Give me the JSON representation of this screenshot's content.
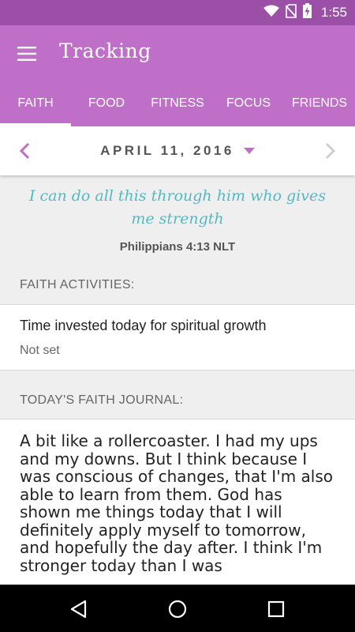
{
  "status_bar": {
    "time": "1:55",
    "icons": [
      "wifi-icon",
      "no-sim-icon",
      "battery-charging-icon"
    ]
  },
  "app_bar": {
    "title": "Tracking",
    "menu_icon": "hamburger-menu-icon"
  },
  "tabs": [
    {
      "label": "FAITH",
      "active": true
    },
    {
      "label": "FOOD",
      "active": false
    },
    {
      "label": "FITNESS",
      "active": false
    },
    {
      "label": "FOCUS",
      "active": false
    },
    {
      "label": "FRIENDS",
      "active": false
    }
  ],
  "date_nav": {
    "date": "APRIL 11, 2016",
    "prev_icon": "chevron-left-icon",
    "next_icon": "chevron-right-icon",
    "dropdown_icon": "caret-down-icon"
  },
  "verse": {
    "text": "I can do all this through him who gives me strength",
    "reference": "Philippians 4:13 NLT"
  },
  "faith_activities": {
    "header": "FAITH ACTIVITIES:",
    "items": [
      {
        "title": "Time invested today for spiritual growth",
        "value": "Not set"
      }
    ]
  },
  "journal": {
    "header": "TODAY'S FAITH JOURNAL:",
    "text": "A bit like a rollercoaster. I had my ups and my downs. But I think because I was conscious of changes, that I'm also able to learn from them. God has shown me things today that I will definitely apply myself to tomorrow, and hopefully the day after. I think I'm stronger today than I was"
  },
  "nav_bar": {
    "icons": [
      "back-icon",
      "home-icon",
      "recents-icon"
    ]
  },
  "colors": {
    "status_bar": "#9b4fa6",
    "app_bar": "#bf6fc7",
    "accent": "#bf6fc7",
    "verse": "#56b8c0"
  }
}
